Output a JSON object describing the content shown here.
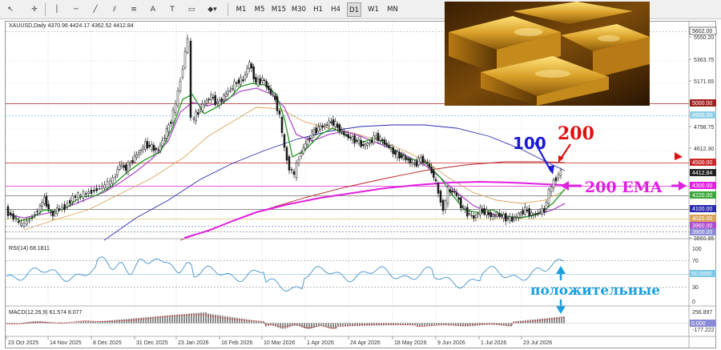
{
  "toolbar": {
    "timeframes": [
      "M1",
      "M5",
      "M15",
      "M30",
      "H1",
      "H4",
      "D1",
      "W1",
      "MN"
    ]
  },
  "chart": {
    "header": "XAUUSD,Daily  4370.96 4424.17 4362.52 4412.84",
    "price_ticks": [
      "5602.00",
      "5550.20",
      "5363.75",
      "5171.65",
      "5000.00",
      "4900.00",
      "4798.75",
      "4612.30",
      "4500.00",
      "4412.84",
      "4300.00",
      "4220.00",
      "4100.00",
      "4020.00",
      "3960.00",
      "3900.00",
      "3860.85"
    ],
    "date_ticks": [
      "23 Oct 2025",
      "14 Nov 2025",
      "8 Dec 2025",
      "31 Dec 2025",
      "23 Jan 2026",
      "16 Feb 2026",
      "10 Mar 2026",
      "1 Apr 2026",
      "24 Apr 2026",
      "18 May 2026",
      "9 Jun 2026",
      "1 Jul 2026",
      "23 Jul 2026"
    ],
    "annotations": {
      "ma100": "100",
      "ma200": "200",
      "ema200": "200 EMA",
      "rsi_note": "положительные"
    },
    "colors": {
      "candle_up": "#1a1a1a",
      "candle_down": "#1a1a1a",
      "ma_green": "#2e9e2e",
      "ma_purple": "#b04ccf",
      "ma_orange": "#d9a35a",
      "ma_blue": "#2b2bb0",
      "ma_red": "#b52323",
      "ema_magenta": "#e020e0",
      "level_red": "#c82828",
      "rsi_line": "#2f86c5",
      "annot_blue": "#1b1bd6",
      "annot_red": "#e01010",
      "annot_magenta": "#e020e0",
      "annot_cyan": "#1aa0e0"
    }
  },
  "rsi": {
    "label": "RSI(14) 68.1811",
    "ticks": [
      "100",
      "70",
      "50.0000",
      "30",
      "0"
    ]
  },
  "macd": {
    "label": "MACD(12,26,9) 61.574 8.077",
    "ticks": [
      "256.897",
      "0.000",
      "-177.222"
    ]
  }
}
